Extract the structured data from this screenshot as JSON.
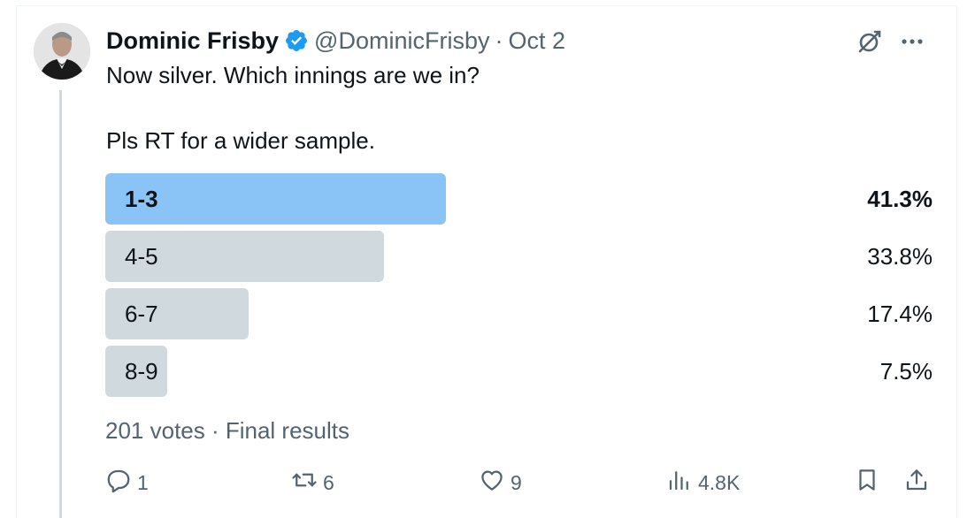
{
  "tweet": {
    "author_name": "Dominic Frisby",
    "handle": "@DominicFrisby",
    "separator": "·",
    "date": "Oct 2",
    "text_line1": "Now silver. Which innings are we in?",
    "text_line2": "Pls RT for a wider sample."
  },
  "poll": {
    "options": [
      {
        "label": "1-3",
        "percent": "41.3%",
        "value": 41.3,
        "winner": true
      },
      {
        "label": "4-5",
        "percent": "33.8%",
        "value": 33.8,
        "winner": false
      },
      {
        "label": "6-7",
        "percent": "17.4%",
        "value": 17.4,
        "winner": false
      },
      {
        "label": "8-9",
        "percent": "7.5%",
        "value": 7.5,
        "winner": false
      }
    ],
    "meta": "201 votes · Final results"
  },
  "actions": {
    "replies": "1",
    "retweets": "6",
    "likes": "9",
    "views": "4.8K"
  },
  "icons": {
    "verified": "verified-badge-icon",
    "grok": "grok-icon",
    "more": "more-icon",
    "reply": "reply-icon",
    "retweet": "retweet-icon",
    "like": "like-icon",
    "views": "views-icon",
    "bookmark": "bookmark-icon",
    "share": "share-icon"
  },
  "colors": {
    "winner_bar": "#8ac4f7",
    "other_bar": "#cfd9de",
    "verified_blue": "#1d9bf0",
    "secondary_text": "#536471"
  }
}
